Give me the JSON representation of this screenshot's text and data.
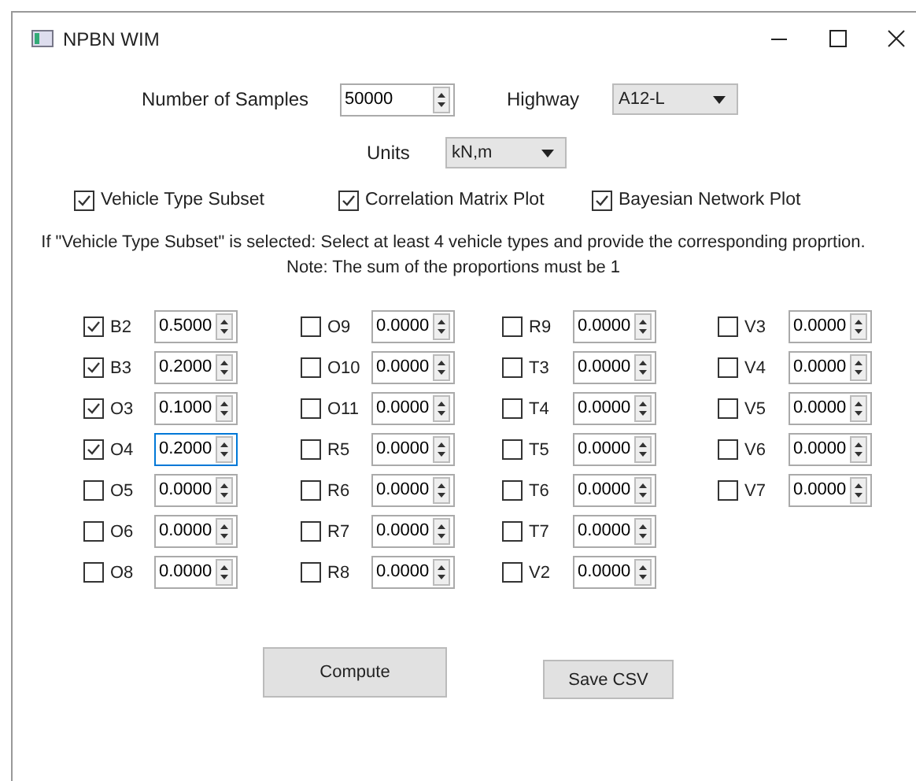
{
  "window": {
    "title": "NPBN WIM"
  },
  "samples": {
    "label": "Number of Samples",
    "value": "50000"
  },
  "highway": {
    "label": "Highway",
    "value": "A12-L"
  },
  "units": {
    "label": "Units",
    "value": "kN,m"
  },
  "options": [
    {
      "label": "Vehicle Type Subset",
      "checked": true
    },
    {
      "label": "Correlation Matrix Plot",
      "checked": true
    },
    {
      "label": "Bayesian Network Plot",
      "checked": true
    }
  ],
  "instructions": [
    "If \"Vehicle Type Subset\" is selected: Select at least 4 vehicle types and provide the corresponding proprtion.",
    "Note: The sum of the proportions must be 1"
  ],
  "vehicle_columns": [
    [
      {
        "label": "B2",
        "checked": true,
        "value": "0.5000",
        "focused": false
      },
      {
        "label": "B3",
        "checked": true,
        "value": "0.2000",
        "focused": false
      },
      {
        "label": "O3",
        "checked": true,
        "value": "0.1000",
        "focused": false
      },
      {
        "label": "O4",
        "checked": true,
        "value": "0.2000",
        "focused": true
      },
      {
        "label": "O5",
        "checked": false,
        "value": "0.0000",
        "focused": false
      },
      {
        "label": "O6",
        "checked": false,
        "value": "0.0000",
        "focused": false
      },
      {
        "label": "O8",
        "checked": false,
        "value": "0.0000",
        "focused": false
      }
    ],
    [
      {
        "label": "O9",
        "checked": false,
        "value": "0.0000",
        "focused": false
      },
      {
        "label": "O10",
        "checked": false,
        "value": "0.0000",
        "focused": false
      },
      {
        "label": "O11",
        "checked": false,
        "value": "0.0000",
        "focused": false
      },
      {
        "label": "R5",
        "checked": false,
        "value": "0.0000",
        "focused": false
      },
      {
        "label": "R6",
        "checked": false,
        "value": "0.0000",
        "focused": false
      },
      {
        "label": "R7",
        "checked": false,
        "value": "0.0000",
        "focused": false
      },
      {
        "label": "R8",
        "checked": false,
        "value": "0.0000",
        "focused": false
      }
    ],
    [
      {
        "label": "R9",
        "checked": false,
        "value": "0.0000",
        "focused": false
      },
      {
        "label": "T3",
        "checked": false,
        "value": "0.0000",
        "focused": false
      },
      {
        "label": "T4",
        "checked": false,
        "value": "0.0000",
        "focused": false
      },
      {
        "label": "T5",
        "checked": false,
        "value": "0.0000",
        "focused": false
      },
      {
        "label": "T6",
        "checked": false,
        "value": "0.0000",
        "focused": false
      },
      {
        "label": "T7",
        "checked": false,
        "value": "0.0000",
        "focused": false
      },
      {
        "label": "V2",
        "checked": false,
        "value": "0.0000",
        "focused": false
      }
    ],
    [
      {
        "label": "V3",
        "checked": false,
        "value": "0.0000",
        "focused": false
      },
      {
        "label": "V4",
        "checked": false,
        "value": "0.0000",
        "focused": false
      },
      {
        "label": "V5",
        "checked": false,
        "value": "0.0000",
        "focused": false
      },
      {
        "label": "V6",
        "checked": false,
        "value": "0.0000",
        "focused": false
      },
      {
        "label": "V7",
        "checked": false,
        "value": "0.0000",
        "focused": false
      }
    ]
  ],
  "buttons": [
    {
      "label": "Compute",
      "kind": "large"
    },
    {
      "label": "Save CSV",
      "kind": "small"
    }
  ]
}
